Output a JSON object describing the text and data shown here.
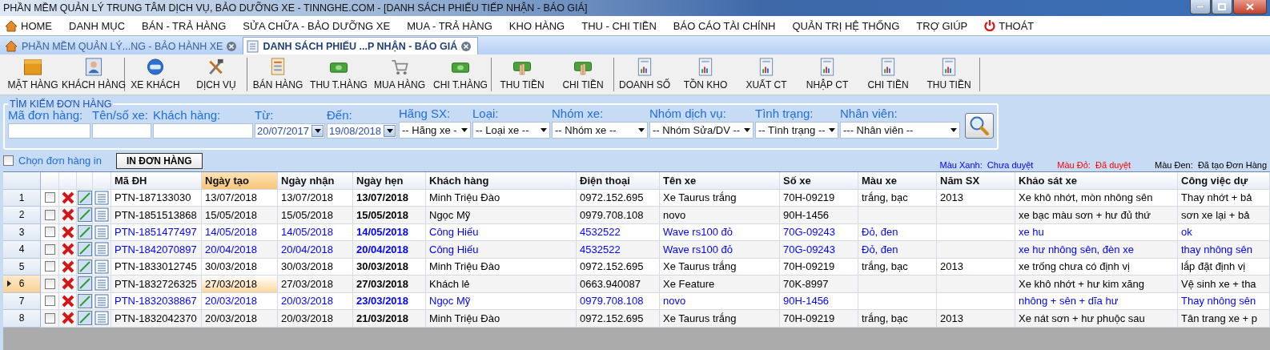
{
  "window": {
    "title": "PHẦN MỀM QUẢN LÝ TRUNG TÂM DỊCH VỤ, BẢO DƯỠNG XE - TINNGHE.COM - [DANH SÁCH PHIẾU TIẾP NHẬN - BÁO GIÁ]"
  },
  "menu": [
    {
      "label": "HOME",
      "kind": "home"
    },
    {
      "label": "DANH MỤC",
      "kind": "plain"
    },
    {
      "label": "BÁN - TRẢ HÀNG",
      "kind": "plain"
    },
    {
      "label": "SỬA CHỮA - BẢO DƯỠNG XE",
      "kind": "plain"
    },
    {
      "label": "MUA - TRẢ HÀNG",
      "kind": "plain"
    },
    {
      "label": "KHO HÀNG",
      "kind": "plain"
    },
    {
      "label": "THU - CHI TIỀN",
      "kind": "plain"
    },
    {
      "label": "BÁO CÁO TÀI CHÍNH",
      "kind": "plain"
    },
    {
      "label": "QUẢN TRỊ HỆ THỐNG",
      "kind": "plain"
    },
    {
      "label": "TRỢ GIÚP",
      "kind": "plain"
    },
    {
      "label": "THOÁT",
      "kind": "exit"
    }
  ],
  "tabs": [
    {
      "label": "PHẦN MỀM QUẢN LÝ...NG - BẢO HÀNH XE",
      "kind": "home",
      "selected": false
    },
    {
      "label": "DANH SÁCH PHIẾU ...P NHẬN - BÁO GIÁ",
      "kind": "list",
      "selected": true
    }
  ],
  "toolbar": [
    [
      {
        "label": "MẶT HÀNG",
        "kind": "box"
      },
      {
        "label": "KHÁCH HÀNG",
        "kind": "person"
      }
    ],
    [
      {
        "label": "XE KHÁCH",
        "kind": "globe"
      },
      {
        "label": "DỊCH VỤ",
        "kind": "tools"
      }
    ],
    [
      {
        "label": "BÁN HÀNG",
        "kind": "register"
      },
      {
        "label": "THU T.HÀNG",
        "kind": "cash"
      },
      {
        "label": "MUA HÀNG",
        "kind": "cart"
      },
      {
        "label": "CHI T.HÀNG",
        "kind": "cash"
      }
    ],
    [
      {
        "label": "THU TIỀN",
        "kind": "hand"
      },
      {
        "label": "CHI TIỀN",
        "kind": "hand"
      }
    ],
    [
      {
        "label": "DOANH SỐ",
        "kind": "report"
      },
      {
        "label": "TỒN KHO",
        "kind": "report"
      },
      {
        "label": "XUẤT CT",
        "kind": "report"
      },
      {
        "label": "NHẬP CT",
        "kind": "report"
      },
      {
        "label": "CHI TIỀN",
        "kind": "report"
      },
      {
        "label": "THU TIỀN",
        "kind": "report"
      }
    ]
  ],
  "search": {
    "title": "TÌM KIẾM ĐƠN HÀNG",
    "fields": [
      {
        "label": "Mã đơn hàng:",
        "kind": "text"
      },
      {
        "label": "Tên/số xe:",
        "kind": "text"
      },
      {
        "label": "Khách hàng:",
        "kind": "text"
      },
      {
        "label": "Từ:",
        "kind": "date",
        "value": "20/07/2017"
      },
      {
        "label": "Đến:",
        "kind": "date",
        "value": "19/08/2018"
      },
      {
        "label": "Hãng SX:",
        "kind": "select",
        "value": "-- Hãng xe -"
      },
      {
        "label": "Loại:",
        "kind": "select",
        "value": "-- Loại xe --"
      },
      {
        "label": "Nhóm xe:",
        "kind": "select",
        "value": "-- Nhóm xe --"
      },
      {
        "label": "Nhóm dịch vụ:",
        "kind": "select",
        "value": "-- Nhóm Sửa/DV --"
      },
      {
        "label": "Tình trạng:",
        "kind": "select",
        "value": "-- Tình trạng --"
      },
      {
        "label": "Nhân viên:",
        "kind": "select",
        "value": "--- Nhân viên --"
      }
    ]
  },
  "print_option": {
    "label": "Chọn đơn hàng in",
    "checked": false
  },
  "print_button": "IN ĐƠN HÀNG",
  "legend": [
    {
      "label": "Màu Xanh:",
      "text": "Chưa duyệt",
      "color": "#0000ff"
    },
    {
      "label": "Màu Đỏ:",
      "text": "Đã duyệt",
      "color": "#ff0000"
    },
    {
      "label": "Màu Đen:",
      "text": "Đã tạo Đơn Hàng",
      "color": "#000000"
    }
  ],
  "table": {
    "columns": [
      {
        "label": "Mã ĐH",
        "selected": false
      },
      {
        "label": "Ngày tạo",
        "selected": true
      },
      {
        "label": "Ngày nhận",
        "selected": false
      },
      {
        "label": "Ngày hẹn",
        "selected": false
      },
      {
        "label": "Khách hàng",
        "selected": false
      },
      {
        "label": "Điện thoại",
        "selected": false
      },
      {
        "label": "Tên xe",
        "selected": false
      },
      {
        "label": "Số xe",
        "selected": false
      },
      {
        "label": "Màu xe",
        "selected": false
      },
      {
        "label": "Năm SX",
        "selected": false
      },
      {
        "label": "Khảo sát xe",
        "selected": false
      },
      {
        "label": "Công việc dự",
        "selected": false
      }
    ],
    "rows": [
      {
        "number": "1",
        "color": "#000000",
        "selected": false,
        "checked": false,
        "cells": [
          "PTN-187133030",
          "13/07/2018",
          "13/07/2018",
          "13/07/2018",
          "Minh Triệu Đào",
          "0972.152.695",
          "Xe Taurus trắng",
          "70H-09219",
          "trắng, bạc",
          "2013",
          "Xe khô nhớt, mòn nhông sên",
          "Thay nhớt + bả"
        ]
      },
      {
        "number": "2",
        "color": "#000000",
        "selected": false,
        "checked": false,
        "cells": [
          "PTN-1851513868",
          "15/05/2018",
          "15/05/2018",
          "15/05/2018",
          "Ngọc Mỹ",
          "0979.708.108",
          "novo",
          "90H-1456",
          "",
          "",
          "xe bạc màu sơn + hư đủ thứ",
          "sơn xe lại + bả"
        ]
      },
      {
        "number": "3",
        "color": "#0000ff",
        "selected": false,
        "checked": false,
        "cells": [
          "PTN-1851477497",
          "14/05/2018",
          "14/05/2018",
          "14/05/2018",
          "Công Hiếu",
          "4532522",
          "Wave rs100 đỏ",
          "70G-09243",
          "Đỏ, đen",
          "",
          "xe hu",
          "ok"
        ]
      },
      {
        "number": "4",
        "color": "#0000ff",
        "selected": false,
        "checked": false,
        "cells": [
          "PTN-1842070897",
          "20/04/2018",
          "20/04/2018",
          "20/04/2018",
          "Công Hiếu",
          "4532522",
          "Wave rs100 đỏ",
          "70G-09243",
          "Đỏ, đen",
          "",
          "xe hư nhông sên, đèn xe",
          "thay nhông sên"
        ]
      },
      {
        "number": "5",
        "color": "#000000",
        "selected": false,
        "checked": false,
        "cells": [
          "PTN-1833012745",
          "30/03/2018",
          "30/03/2018",
          "30/03/2018",
          "Minh Triệu Đào",
          "0972.152.695",
          "Xe Taurus trắng",
          "70H-09219",
          "trắng, bạc",
          "2013",
          "xe trống chưa có định vị",
          "lắp đặt định vị"
        ]
      },
      {
        "number": "6",
        "color": "#000000",
        "selected": true,
        "checked": false,
        "cells": [
          "PTN-1832726325",
          "27/03/2018",
          "27/03/2018",
          "27/03/2018",
          "Khách lẻ",
          "0663.940087",
          "Xe Feature",
          "70K-8997",
          "",
          "",
          "Xe khô nhớt + hư kim xăng",
          "Vệ sinh xe + tha"
        ]
      },
      {
        "number": "7",
        "color": "#0000ff",
        "selected": false,
        "checked": false,
        "cells": [
          "PTN-1832038867",
          "20/03/2018",
          "20/03/2018",
          "23/03/2018",
          "Ngọc Mỹ",
          "0979.708.108",
          "novo",
          "90H-1456",
          "",
          "",
          "nhông + sên + dĩa hư",
          "Thay nhông sên"
        ]
      },
      {
        "number": "8",
        "color": "#000000",
        "selected": false,
        "checked": false,
        "cells": [
          "PTN-1832042370",
          "20/03/2018",
          "20/03/2018",
          "21/03/2018",
          "Minh Triệu Đào",
          "0972.152.695",
          "Xe Taurus trắng",
          "70H-09219",
          "trắng, bạc",
          "2013",
          "Xe nát sơn + hư phuộc sau",
          "Tân trang xe + p"
        ]
      }
    ]
  }
}
